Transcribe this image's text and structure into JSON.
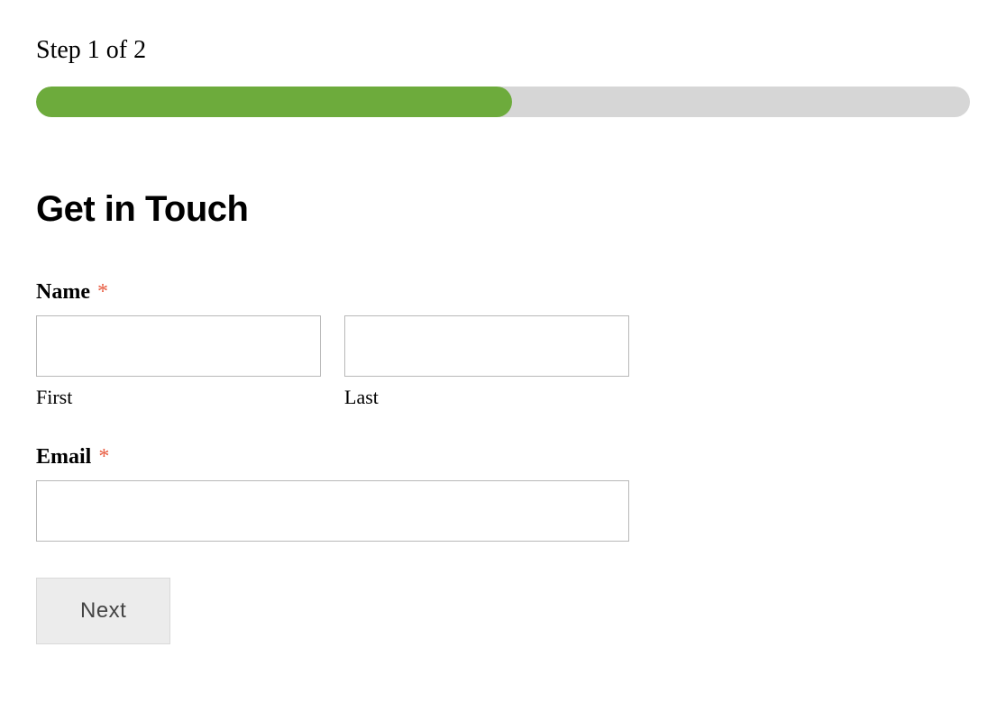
{
  "step": {
    "label": "Step 1 of 2",
    "current": 1,
    "total": 2,
    "progress_percent": 51
  },
  "form": {
    "title": "Get in Touch",
    "name": {
      "label": "Name",
      "required_marker": "*",
      "first": {
        "sublabel": "First",
        "value": ""
      },
      "last": {
        "sublabel": "Last",
        "value": ""
      }
    },
    "email": {
      "label": "Email",
      "required_marker": "*",
      "value": ""
    },
    "next_button": "Next"
  }
}
